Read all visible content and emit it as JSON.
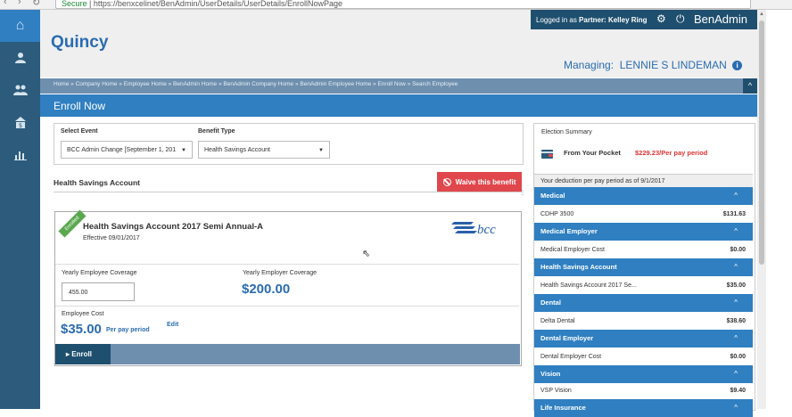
{
  "browser": {
    "security_label": "Secure",
    "url_text": "https://benxcelinet/BenAdmin/UserDetails/UserDetails/EnrollNowPage"
  },
  "user": {
    "prefix": "Logged in as ",
    "role_name": "Partner: Kelley Ring"
  },
  "app_name": "BenAdmin",
  "company": "Quincy",
  "managing": {
    "label": "Managing:",
    "name": "LENNIE S LINDEMAN"
  },
  "breadcrumb": "Home » Company Home » Employee Home » BenAdmin Home » BenAdmin Company Home » BenAdmin Employee Home » Enroll Now » Search Employee",
  "page_title": "Enroll Now",
  "select_event": {
    "label": "Select Event",
    "value": "BCC Admin Change [September 1, 201"
  },
  "benefit_type": {
    "label": "Benefit Type",
    "value": "Health Savings Account"
  },
  "section_title": "Health Savings Account",
  "waive_label": "Waive this benefit",
  "plan": {
    "ribbon": "Enrolled",
    "name": "Health Savings Account 2017 Semi Annual-A",
    "effective": "Effective 09/01/2017",
    "logo_text": "bcc",
    "yearly_employee_label": "Yearly Employee Coverage",
    "yearly_employee_value": "455.00",
    "yearly_employer_label": "Yearly Employer Coverage",
    "yearly_employer_value": "$200.00",
    "employee_cost_label": "Employee Cost",
    "employee_cost_value": "$35.00",
    "per_pay_label": "Per pay period",
    "edit_label": "Edit",
    "enroll_label": "Enroll"
  },
  "election_summary": {
    "title": "Election Summary",
    "pocket_label": "From Your Pocket",
    "pocket_value": "$229.23/Per pay period",
    "deduction_note": "Your deduction per pay period as of 9/1/2017",
    "sections": [
      {
        "title": "Medical",
        "item": "CDHP 3500",
        "amount": "$131.63"
      },
      {
        "title": "Medical Employer",
        "item": "Medical Employer Cost",
        "amount": "$0.00"
      },
      {
        "title": "Health Savings Account",
        "item": "Health Savings Account 2017 Se...",
        "amount": "$35.00"
      },
      {
        "title": "Dental",
        "item": "Delta Dental",
        "amount": "$38.60"
      },
      {
        "title": "Dental Employer",
        "item": "Dental Employer Cost",
        "amount": "$0.00"
      },
      {
        "title": "Vision",
        "item": "VSP Vision",
        "amount": "$9.40"
      },
      {
        "title": "Life Insurance",
        "item": "",
        "amount": ""
      }
    ]
  },
  "colors": {
    "sidebar": "#2c5b7c",
    "primary": "#2f7fc1",
    "accent_red": "#e0474c",
    "enrolled_green": "#5aa84e"
  },
  "icons": [
    "home-icon",
    "user-icon",
    "users-icon",
    "money-icon",
    "chart-icon",
    "gear-icon",
    "power-icon",
    "info-icon",
    "ban-icon",
    "wallet-icon",
    "chevron-up-icon"
  ]
}
